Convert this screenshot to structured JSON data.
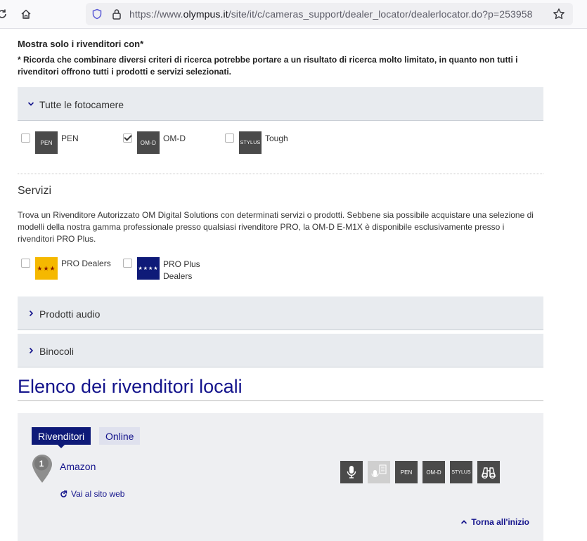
{
  "browser": {
    "url_prefix": "https://www.",
    "url_domain": "olympus.it",
    "url_path": "/site/it/c/cameras_support/dealer_locator/dealerlocator.do?p=253958",
    "icons": [
      "reload-icon",
      "home-icon",
      "shield-icon",
      "lock-icon",
      "star-icon"
    ]
  },
  "filters": {
    "heading": "Mostra solo i rivenditori con*",
    "note": "* Ricorda che combinare diversi criteri di ricerca potrebbe portare a un risultato di ricerca molto limitato, in quanto non tutti i rivenditori offrono tutti i prodotti e servizi selezionati.",
    "cameras_title": "Tutte le fotocamere",
    "cameras": [
      {
        "logo": "PEN",
        "label": "PEN",
        "checked": false
      },
      {
        "logo": "OM-D",
        "label": "OM-D",
        "checked": true
      },
      {
        "logo": "STYLUS",
        "label": "Tough",
        "checked": false
      }
    ]
  },
  "services": {
    "title": "Servizi",
    "description": "Trova un Rivenditore Autorizzato OM Digital Solutions con determinati servizi o prodotti. Sebbene sia possibile acquistare una selezione di modelli della nostra gamma professionale presso qualsiasi rivenditore PRO, la OM-D E-M1X è disponibile esclusivamente presso i rivenditori PRO Plus.",
    "options": [
      {
        "logo": "★★★",
        "label": "PRO Dealers",
        "color": "#f5b800",
        "checked": false
      },
      {
        "logo": "★★★★",
        "label_line1": "PRO Plus",
        "label_line2": "Dealers",
        "color": "#0e1a78",
        "checked": false
      }
    ]
  },
  "accordions": {
    "audio": "Prodotti audio",
    "binocoli": "Binocoli"
  },
  "list": {
    "title": "Elenco dei rivenditori locali",
    "tabs": [
      "Rivenditori",
      "Online"
    ],
    "dealer": {
      "number": "1",
      "name": "Amazon",
      "website": "Vai al sito web",
      "service_icons": [
        "microphone-icon",
        "voice-recorder-icon",
        "PEN",
        "OM-D",
        "STYLUS",
        "binoculars-icon"
      ]
    },
    "back_to_top": "Torna all'inizio"
  },
  "colors": {
    "brand_blue": "#14148c",
    "accordion_bg": "#e8ebef",
    "results_bg": "#eeeff2",
    "pro_gold": "#f5b800"
  }
}
